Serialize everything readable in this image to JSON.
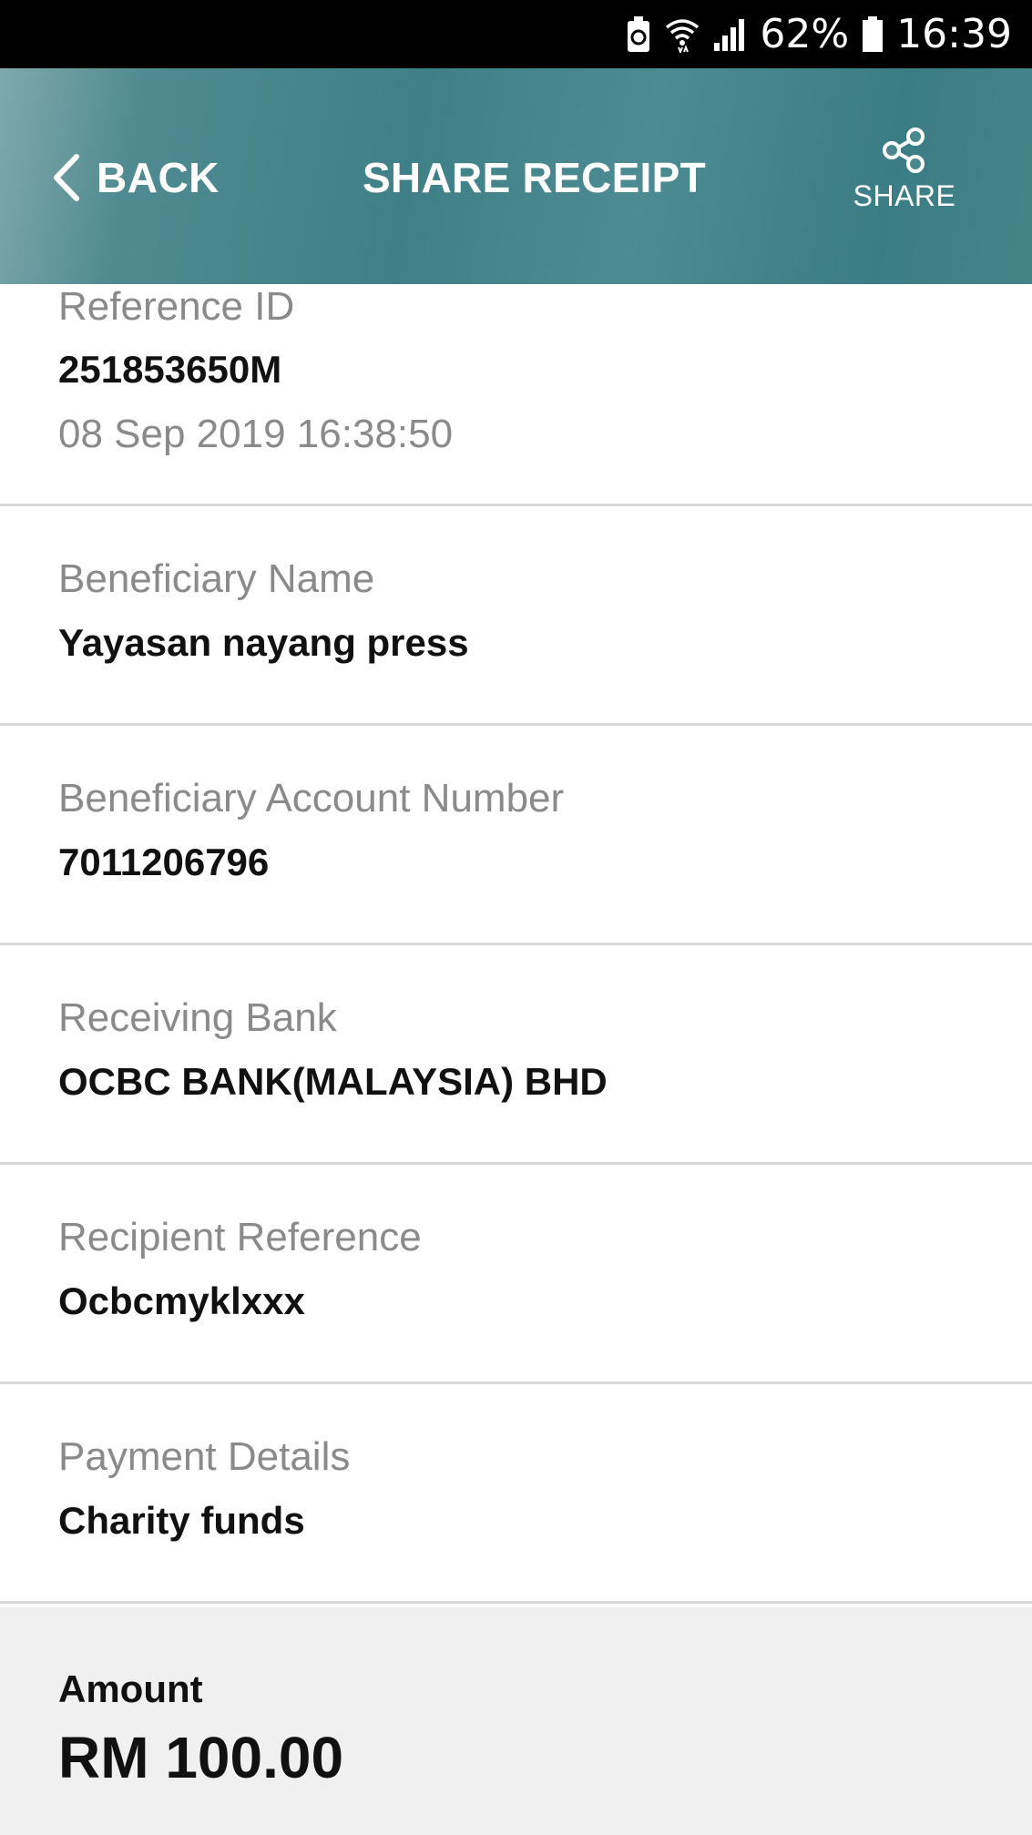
{
  "status_bar": {
    "battery_percent": "62%",
    "time": "16:39",
    "icons": [
      "battery-saver-icon",
      "wifi-icon",
      "signal-icon",
      "battery-icon"
    ]
  },
  "header": {
    "back_label": "BACK",
    "title": "SHARE RECEIPT",
    "share_label": "SHARE",
    "colors": {
      "header_bg": "#3f8088",
      "text": "#ffffff"
    }
  },
  "receipt": {
    "reference": {
      "label": "Reference ID",
      "value": "251853650M",
      "datetime": "08 Sep 2019 16:38:50"
    },
    "beneficiary_name": {
      "label": "Beneficiary Name",
      "value": "Yayasan nayang press"
    },
    "beneficiary_account": {
      "label": "Beneficiary Account Number",
      "value": "7011206796"
    },
    "receiving_bank": {
      "label": "Receiving Bank",
      "value": "OCBC BANK(MALAYSIA) BHD"
    },
    "recipient_reference": {
      "label": "Recipient Reference",
      "value": "Ocbcmyklxxx"
    },
    "payment_details": {
      "label": "Payment Details",
      "value": "Charity funds"
    },
    "amount": {
      "label": "Amount",
      "value": "RM 100.00"
    }
  }
}
